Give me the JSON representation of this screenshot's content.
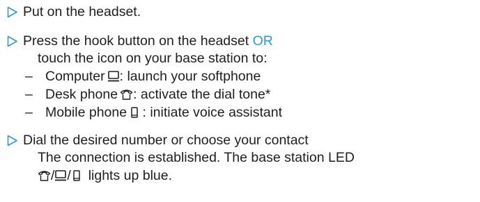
{
  "steps": [
    {
      "text": "Put on the headset."
    },
    {
      "line1_prefix": "Press the hook button on the headset",
      "line1_or": "OR",
      "line2": "touch the icon on your base station to:",
      "items": [
        {
          "dash": "–",
          "label": "Computer",
          "icon": "computer-icon",
          "desc": ":  launch your softphone"
        },
        {
          "dash": "–",
          "label": "Desk phone",
          "icon": "desk-phone-icon",
          "desc": ": activate the dial tone*"
        },
        {
          "dash": "–",
          "label": "Mobile phone",
          "icon": "mobile-phone-icon",
          "desc": " : initiate voice assistant"
        }
      ]
    },
    {
      "line1": "Dial the desired number or choose your contact",
      "line2": "The connection is established. The base station LED",
      "line3_suffix": "lights up blue.",
      "icons": [
        "desk-phone-icon",
        "computer-icon",
        "mobile-phone-icon"
      ],
      "separator": "/"
    }
  ],
  "colors": {
    "accent": "#2f9ad6",
    "text": "#1e1e1e"
  }
}
